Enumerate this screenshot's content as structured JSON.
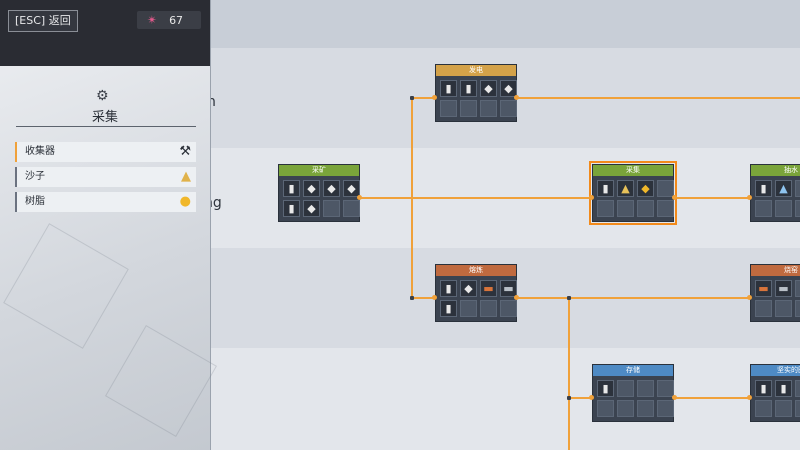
{
  "topbar": {
    "esc_label": "[ESC] 返回",
    "resource_icon": "network-nodes-icon",
    "resource_count": "67",
    "resource_color": "#e35a8c"
  },
  "category": {
    "icon": "gear-wrench-icon",
    "title": "采集"
  },
  "items": [
    {
      "label": "收集器",
      "icon": "collector-icon"
    },
    {
      "label": "沙子",
      "icon": "sand-pile-icon"
    },
    {
      "label": "树脂",
      "icon": "resin-icon"
    }
  ],
  "tree": {
    "row_labels_partial": [
      "n",
      "ng"
    ],
    "nodes": [
      {
        "title": "发电",
        "header_color": "#d4a249",
        "slots": [
          "▮",
          "▮",
          "◆",
          "◆",
          "",
          "",
          "",
          ""
        ]
      },
      {
        "title": "采矿",
        "header_color": "#7aa43a",
        "slots": [
          "▮",
          "◆",
          "◆",
          "◆",
          "▮",
          "◆",
          "",
          ""
        ]
      },
      {
        "title": "采集",
        "header_color": "#7aa43a",
        "slots": [
          "▮",
          "▲",
          "◆",
          "",
          "",
          "",
          "",
          ""
        ]
      },
      {
        "title": "抽水",
        "header_color": "#7aa43a",
        "slots": [
          "▮",
          "▲",
          "",
          "",
          "",
          "",
          "",
          ""
        ]
      },
      {
        "title": "熔炼",
        "header_color": "#c06a3f",
        "slots": [
          "▮",
          "◆",
          "▬",
          "▬",
          "▮",
          "",
          "",
          ""
        ]
      },
      {
        "title": "烧窑",
        "header_color": "#c06a3f",
        "slots": [
          "▬",
          "▬",
          "",
          "",
          "",
          "",
          "",
          ""
        ]
      },
      {
        "title": "存储",
        "header_color": "#4e8ac4",
        "slots": [
          "▮",
          "",
          "",
          "",
          "",
          "",
          "",
          ""
        ]
      },
      {
        "title": "坚实的田",
        "header_color": "#4e8ac4",
        "slots": [
          "▮",
          "▮",
          "",
          "",
          "",
          "",
          "",
          ""
        ]
      }
    ],
    "wire_color": "#f0a13a"
  }
}
